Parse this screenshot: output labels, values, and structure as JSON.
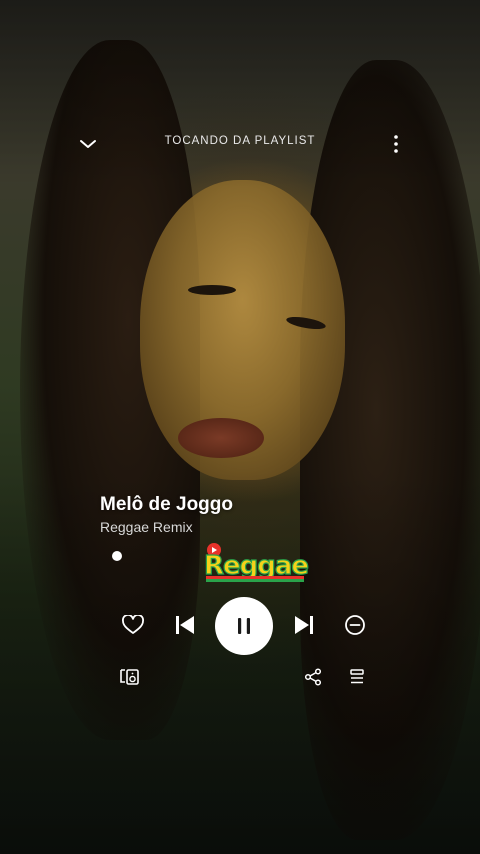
{
  "header": {
    "title": "TOCANDO DA PLAYLIST",
    "collapse_icon": "chevron-down-icon",
    "menu_icon": "more-vertical-icon"
  },
  "track": {
    "title": "Melô de Joggo",
    "artist": "Reggae Remix"
  },
  "logo": {
    "text": "Reggae",
    "colors": [
      "#e8322b",
      "#f6d21a",
      "#2aa34a"
    ]
  },
  "playback": {
    "state": "playing",
    "progress": 0.0
  },
  "controls": {
    "like_icon": "heart-icon",
    "prev_icon": "skip-previous-icon",
    "play_pause_icon": "pause-icon",
    "next_icon": "skip-next-icon",
    "remove_icon": "minus-circle-icon",
    "device_icon": "connect-device-icon",
    "share_icon": "share-icon",
    "queue_icon": "queue-icon"
  }
}
